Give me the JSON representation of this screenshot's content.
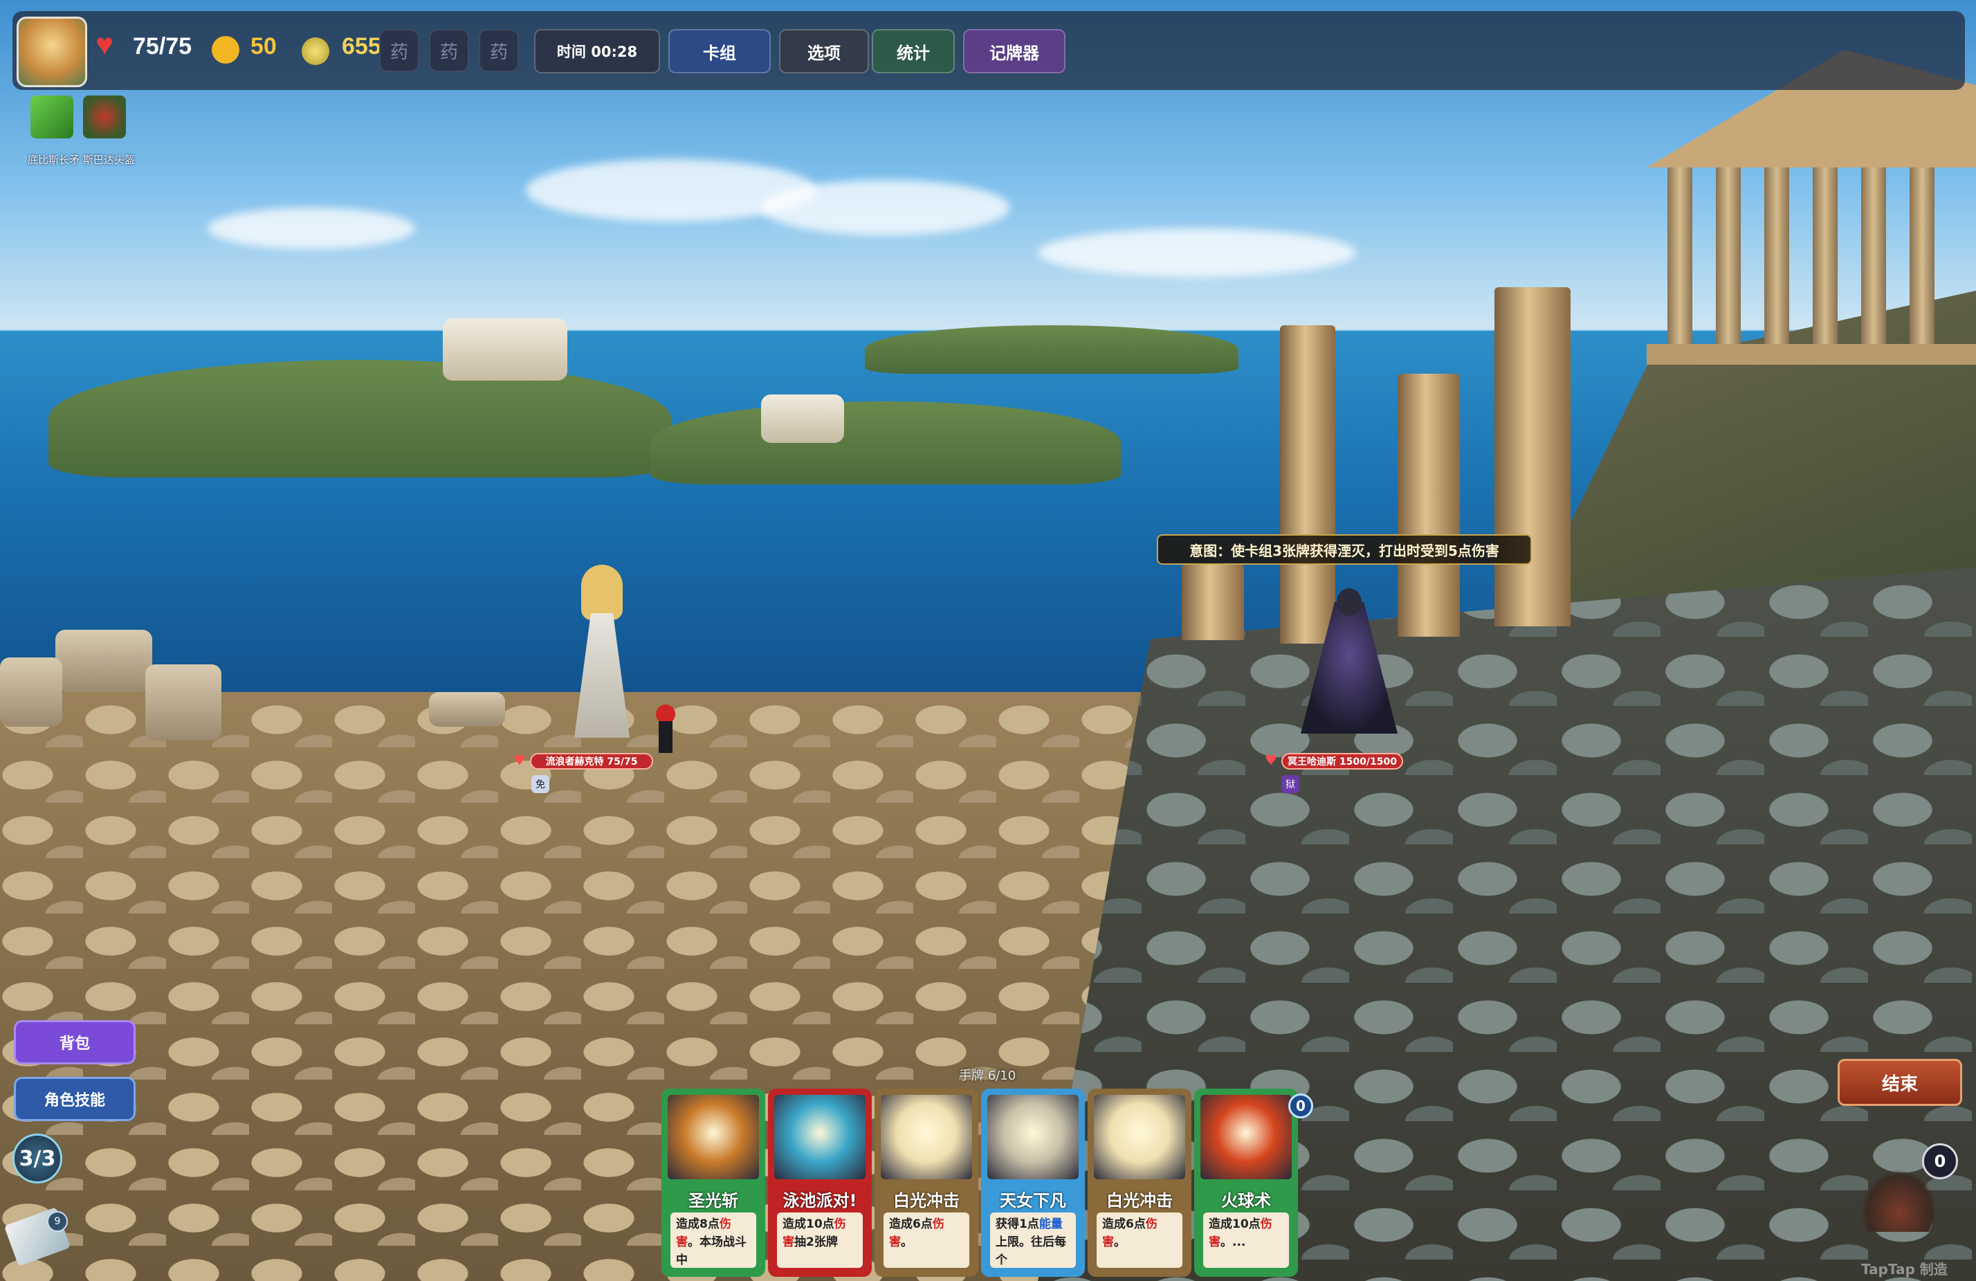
{
  "player": {
    "hp": "75/75",
    "gold": "50",
    "gems": "655"
  },
  "potions": [
    "药",
    "药",
    "药"
  ],
  "toolbar": {
    "timer": "时间 00:28",
    "deck": "卡组",
    "options": "选项",
    "stats": "统计",
    "card_tracker": "记牌器"
  },
  "relics_label": "底比斯长矛 斯巴达头盔",
  "hero": {
    "hp_label": "流浪者赫克特 75/75",
    "buff": "免"
  },
  "enemy": {
    "intent": "意图：使卡组3张牌获得湮灭，打出时受到5点伤害",
    "hp_label": "冥王哈迪斯 1500/1500",
    "buff": "狱"
  },
  "left_panel": {
    "bag": "背包",
    "skills": "角色技能",
    "energy": "3/3",
    "draw_pile_count": "9"
  },
  "hand_label": "手牌 6/10",
  "cards": [
    {
      "name": "圣光斩",
      "desc_pre": "造成8点",
      "desc_hl": "伤害",
      "desc_post": "。本场战斗中",
      "border": "#2f9a4a",
      "art": "#c97a2a"
    },
    {
      "name": "泳池派对!",
      "desc_pre": "造成10点",
      "desc_hl": "伤害",
      "desc_post": "抽2张牌",
      "border": "#c02323",
      "art": "#3aa6c8"
    },
    {
      "name": "白光冲击",
      "desc_pre": "造成6点",
      "desc_hl": "伤害",
      "desc_post": "。",
      "border": "#8a6a3a",
      "art": "#f0e0b0"
    },
    {
      "name": "天女下凡",
      "desc_pre": "获得1点",
      "desc_hl": "能量",
      "desc_post": "上限。往后每个",
      "border": "#3a9ad8",
      "art": "#c8c0a8"
    },
    {
      "name": "白光冲击",
      "desc_pre": "造成6点",
      "desc_hl": "伤害",
      "desc_post": "。",
      "border": "#8a6a3a",
      "art": "#f0e0b0"
    },
    {
      "name": "火球术",
      "desc_pre": "造成10点",
      "desc_hl": "伤害",
      "desc_post": "。...",
      "border": "#2f9a4a",
      "art": "#d4451e"
    }
  ],
  "last_card_cost": "0",
  "end_turn": "结束",
  "discard_count": "0",
  "watermark": "TapTap 制造"
}
